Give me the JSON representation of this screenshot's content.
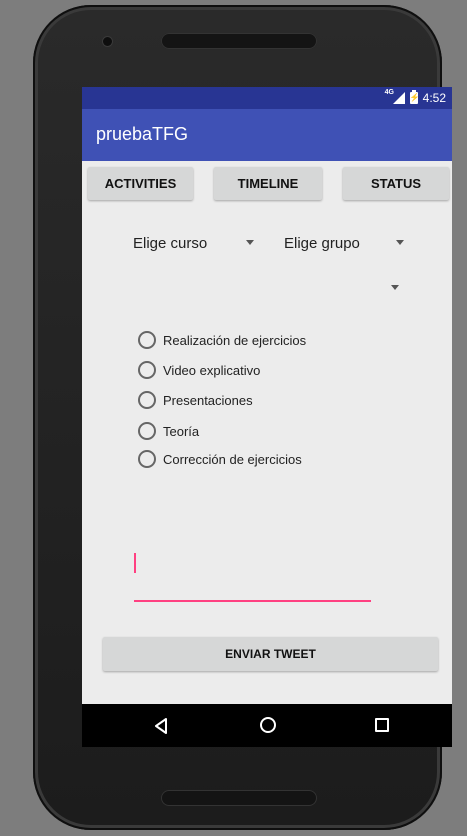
{
  "status_bar": {
    "network_label": "4G",
    "time": "4:52"
  },
  "app_bar": {
    "title": "pruebaTFG"
  },
  "tabs": [
    {
      "label": "ACTIVITIES"
    },
    {
      "label": "TIMELINE"
    },
    {
      "label": "STATUS"
    }
  ],
  "spinners": {
    "course": "Elige curso",
    "group": "Elige grupo",
    "third": ""
  },
  "radio_options": [
    {
      "label": "Realización de ejercicios",
      "checked": false
    },
    {
      "label": "Video explicativo",
      "checked": false
    },
    {
      "label": "Presentaciones",
      "checked": false
    },
    {
      "label": "Teoría",
      "checked": false
    },
    {
      "label": "Corrección de ejercicios",
      "checked": false
    }
  ],
  "tweet_input": {
    "value": "",
    "placeholder": ""
  },
  "send_button": {
    "label": "ENVIAR TWEET"
  },
  "nav_icons": [
    "back-icon",
    "home-icon",
    "recents-icon"
  ],
  "colors": {
    "status_bar": "#283593",
    "app_bar": "#3f51b5",
    "accent": "#ff4081",
    "background": "#ececec"
  }
}
